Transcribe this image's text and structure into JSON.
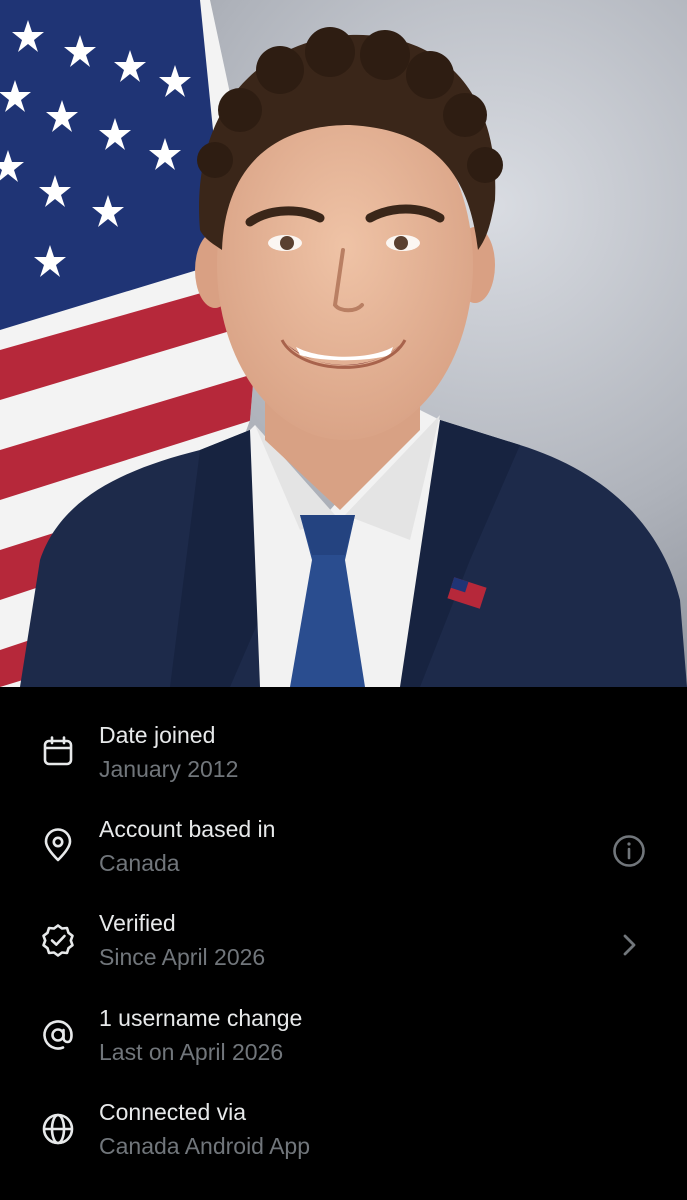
{
  "profile_photo": {
    "icon": "profile-portrait-photo",
    "colors": {
      "suit": "#1d2a4a",
      "tie": "#2a4d8f",
      "shirt": "#f2f2f2",
      "skin": "#e6b497",
      "hair": "#3a2619",
      "flag_blue": "#1f3475",
      "flag_red": "#b6283a"
    }
  },
  "about_account": {
    "rows": [
      {
        "icon": "calendar-icon",
        "title": "Date joined",
        "subtitle": "January 2012"
      },
      {
        "icon": "location-pin-icon",
        "title": "Account based in",
        "subtitle": "Canada",
        "trailing_icon": "info-icon"
      },
      {
        "icon": "verified-badge-icon",
        "title": "Verified",
        "subtitle": "Since April 2026",
        "trailing_icon": "chevron-right-icon"
      },
      {
        "icon": "at-sign-icon",
        "title": "1 username change",
        "subtitle": "Last on April 2026"
      },
      {
        "icon": "globe-icon",
        "title": "Connected via",
        "subtitle": "Canada Android App"
      }
    ]
  },
  "colors": {
    "background": "#000000",
    "primary_text": "#e7e9ea",
    "secondary_text": "#71767b",
    "icon": "#e7e9ea"
  }
}
